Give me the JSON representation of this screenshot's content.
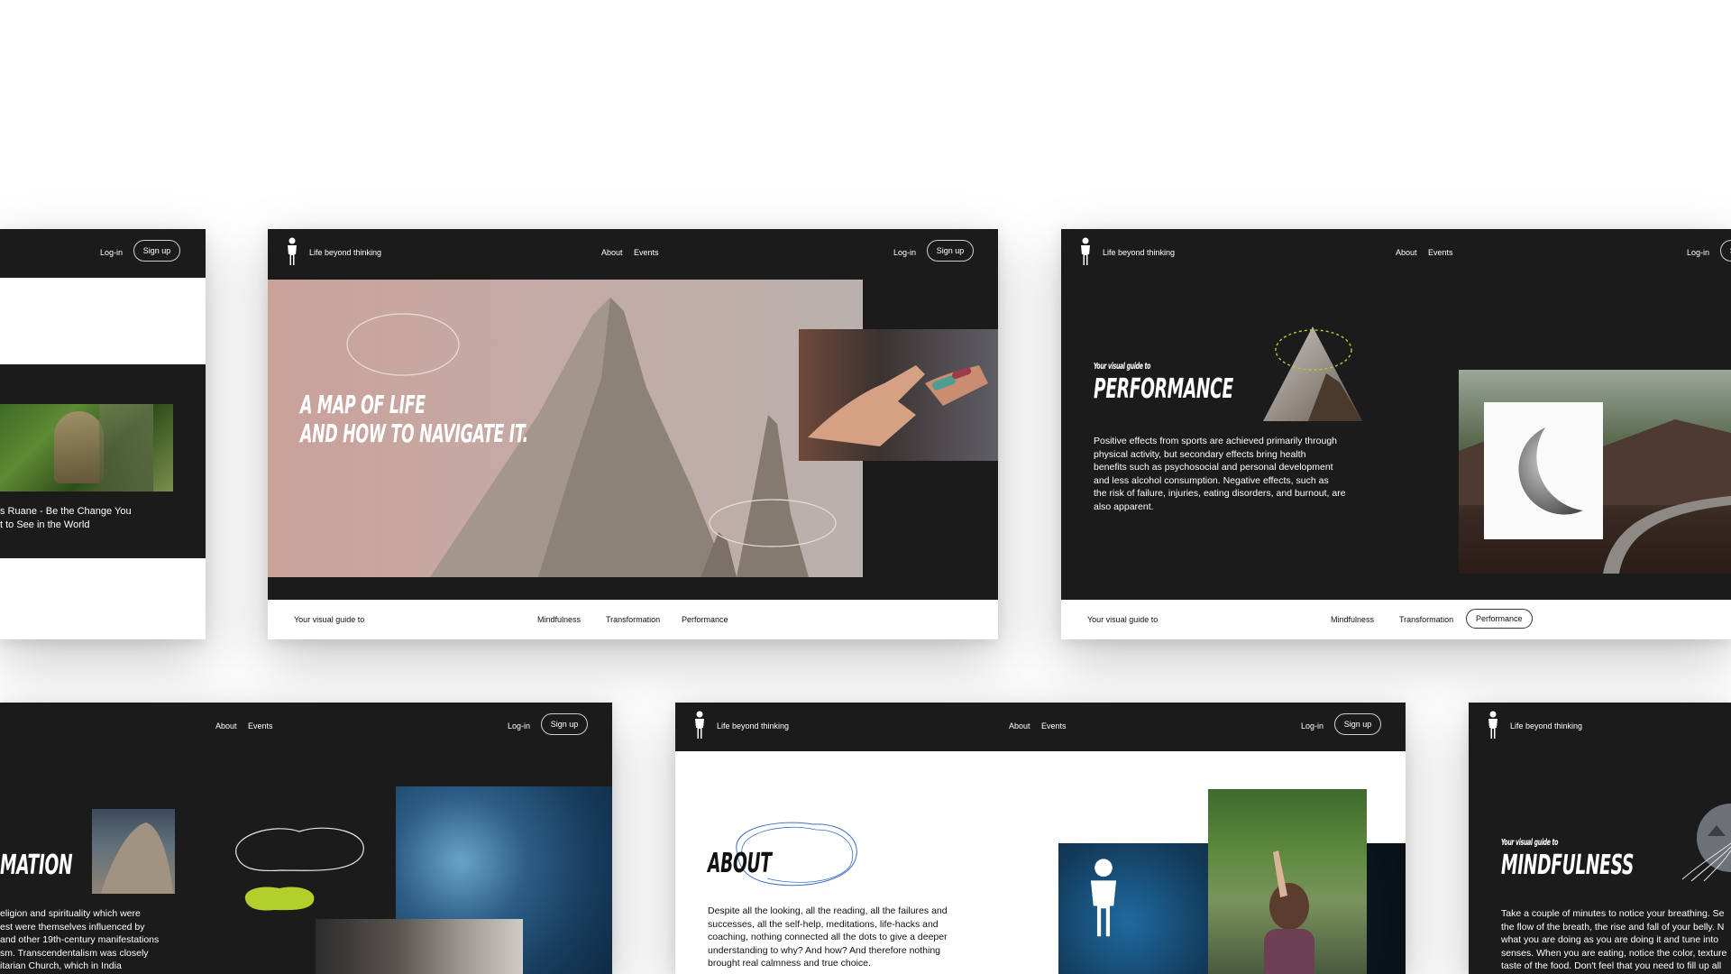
{
  "nav": {
    "brand": "Life beyond thinking",
    "about": "About",
    "events": "Events",
    "login": "Log-in",
    "signup": "Sign up"
  },
  "bottom_nav": {
    "label": "Your visual guide to",
    "mindfulness": "Mindfulness",
    "transformation": "Transformation",
    "performance": "Performance"
  },
  "card_left_partial": {
    "caption_line1": "s Ruane - Be the Change You",
    "caption_line2": "t to See in the World"
  },
  "card_home": {
    "headline_line1": "A MAP OF LIFE",
    "headline_line2": "AND HOW TO NAVIGATE IT."
  },
  "card_performance": {
    "kicker": "Your visual guide to",
    "title": "PERFORMANCE",
    "text_lines": [
      "Positive effects from sports are achieved primarily through",
      "physical activity, but secondary effects bring health",
      "benefits such as psychosocial and personal development",
      "and less alcohol consumption. Negative effects, such as",
      "the risk of failure, injuries, eating disorders, and burnout, are",
      "also apparent."
    ]
  },
  "card_transformation": {
    "title_partial": "MATION",
    "text_lines": [
      "eligion and spirituality which were",
      "est were themselves influenced by",
      "and other 19th-century manifestations",
      "sm. Transcendentalism was closely",
      "itarian Church, which in India"
    ]
  },
  "card_about": {
    "title": "ABOUT",
    "text_lines": [
      "Despite all the looking, all the reading, all the failures and",
      "successes, all the self-help, meditations, life-hacks and",
      "coaching, nothing connected all the dots to give a deeper",
      "understanding to why? And how? And therefore nothing",
      "brought real calmness and true choice."
    ]
  },
  "card_mindfulness": {
    "kicker": "Your visual guide to",
    "title": "MINDFULNESS",
    "text_lines": [
      "Take a couple of minutes to notice your breathing. Se",
      "the flow of the breath, the rise and fall of your belly. N",
      "what you are doing as you are doing it and tune into",
      "senses. When you are eating, notice the color, texture",
      "taste of the food. Don't feel that you need to fill up all"
    ]
  },
  "colors": {
    "dark": "#1b1b1b",
    "accent_lime": "#b3cf2c",
    "accent_blue": "#3a6fc4"
  }
}
